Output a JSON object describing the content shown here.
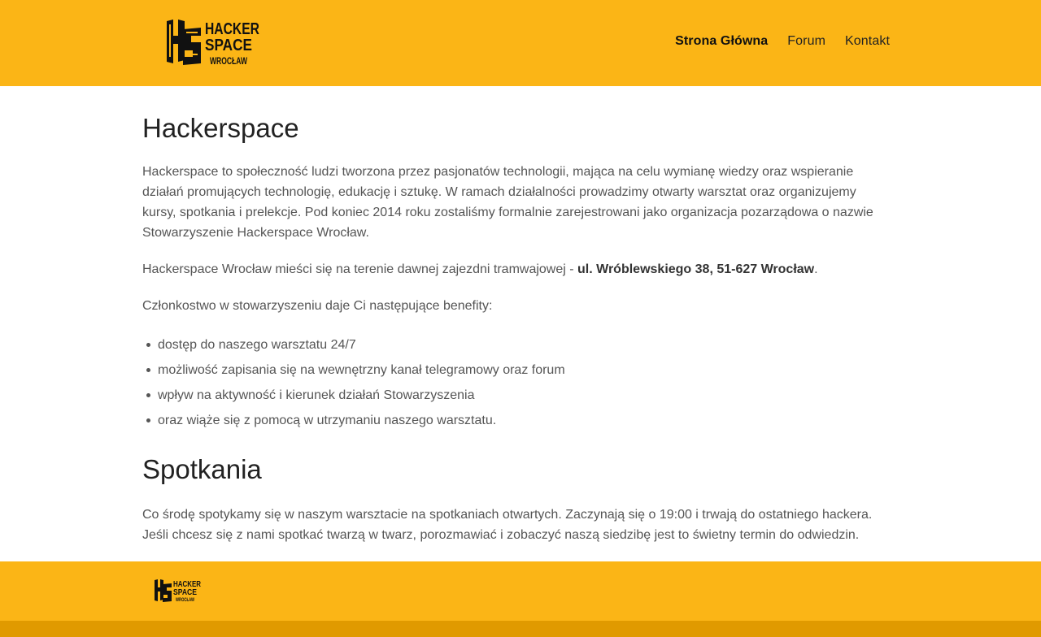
{
  "header": {
    "logo_text": [
      "HACKER",
      "SPACE",
      "WROCŁAW"
    ],
    "nav": [
      {
        "label": "Strona Główna",
        "active": true
      },
      {
        "label": "Forum",
        "active": false
      },
      {
        "label": "Kontakt",
        "active": false
      }
    ]
  },
  "main": {
    "title": "Hackerspace",
    "intro": "Hackerspace to społeczność ludzi tworzona przez pasjonatów technologii, mająca na celu wymianę wiedzy oraz wspieranie działań promujących technologię, edukację i sztukę. W ramach działalności prowadzimy otwarty warsztat oraz organizujemy kursy, spotkania i prelekcje. Pod koniec 2014 roku zostaliśmy formalnie zarejestrowani jako organizacja pozarządowa o nazwie Stowarzyszenie Hackerspace Wrocław.",
    "location_prefix": "Hackerspace Wrocław mieści się na terenie dawnej zajezdni tramwajowej - ",
    "location_address": "ul. Wróblewskiego 38, 51-627 Wrocław",
    "location_suffix": ".",
    "benefits_intro": "Członkostwo w stowarzyszeniu daje Ci następujące benefity:",
    "benefits": [
      "dostęp do naszego warsztatu 24/7",
      "możliwość zapisania się na wewnętrzny kanał telegramowy oraz forum",
      "wpływ na aktywność i kierunek działań Stowarzyszenia",
      "oraz wiąże się z pomocą w utrzymaniu naszego warsztatu."
    ],
    "meetings_title": "Spotkania",
    "meetings_text": "Co środę spotykamy się w naszym warsztacie na spotkaniach otwartych. Zaczynają się o 19:00 i trwają do ostatniego hackera. Jeśli chcesz się z nami spotkać twarzą w twarz, porozmawiać i zobaczyć naszą siedzibę jest to świetny termin do odwiedzin."
  },
  "footer": {
    "logo_text": [
      "HACKER",
      "SPACE",
      "WROCŁAW"
    ]
  },
  "colors": {
    "brand_yellow": "#fbb516",
    "bottom_bar": "#e09a00"
  }
}
